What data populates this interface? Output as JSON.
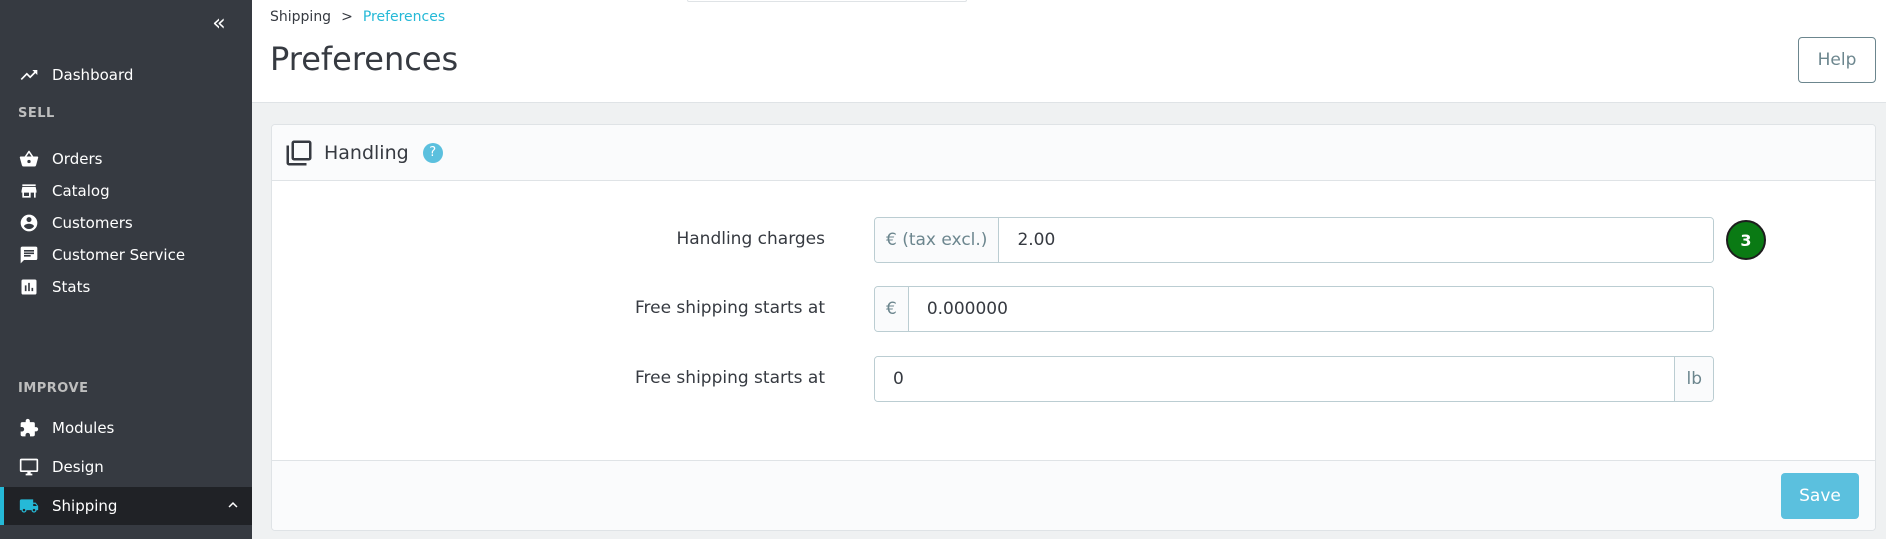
{
  "sidebar": {
    "collapse_glyph": "«",
    "items": [
      {
        "label": "Dashboard",
        "icon": "trending-up-icon"
      },
      {
        "label": "Orders",
        "icon": "basket-icon"
      },
      {
        "label": "Catalog",
        "icon": "store-icon"
      },
      {
        "label": "Customers",
        "icon": "account-circle-icon"
      },
      {
        "label": "Customer Service",
        "icon": "chat-icon"
      },
      {
        "label": "Stats",
        "icon": "bar-chart-icon"
      },
      {
        "label": "Modules",
        "icon": "puzzle-icon"
      },
      {
        "label": "Design",
        "icon": "desktop-icon"
      },
      {
        "label": "Shipping",
        "icon": "truck-icon"
      }
    ],
    "sections": {
      "sell": "SELL",
      "improve": "IMPROVE"
    }
  },
  "breadcrumb": {
    "parent": "Shipping",
    "separator": ">",
    "current": "Preferences"
  },
  "header": {
    "title": "Preferences",
    "help_label": "Help"
  },
  "handling": {
    "title": "Handling",
    "help_glyph": "?",
    "fields": [
      {
        "label": "Handling charges",
        "prefix": "€ (tax excl.)",
        "value": "2.00"
      },
      {
        "label": "Free shipping starts at",
        "prefix": "€",
        "value": "0.000000"
      },
      {
        "label": "Free shipping starts at",
        "suffix": "lb",
        "value": "0"
      }
    ],
    "badge": "3",
    "save_label": "Save"
  },
  "colors": {
    "sidebar_bg": "#363a41",
    "accent": "#25b9d7",
    "save_button": "#5bc0de",
    "badge": "#0a7a14"
  }
}
